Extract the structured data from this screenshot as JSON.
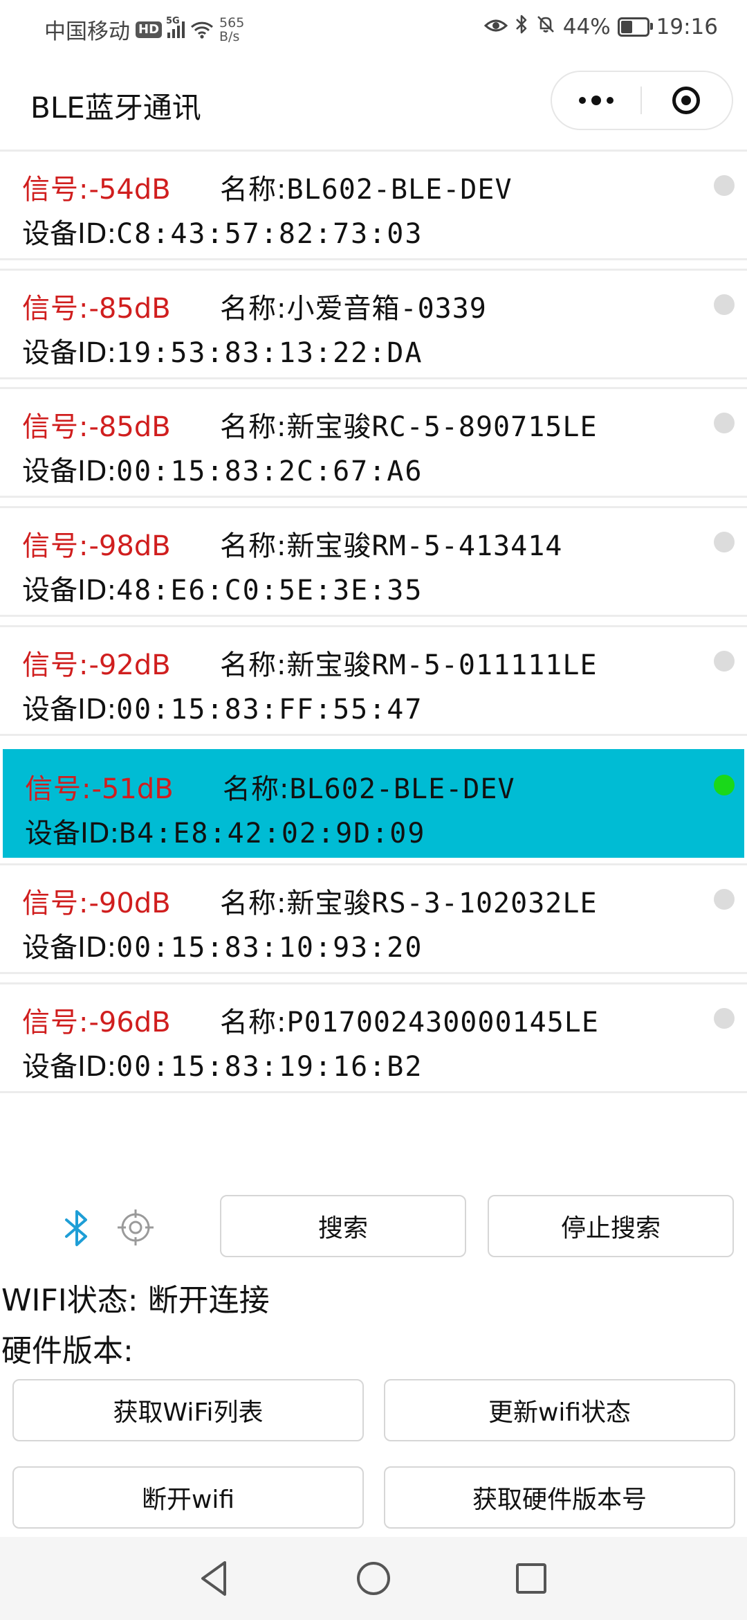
{
  "status_bar": {
    "carrier": "中国移动",
    "hd_label": "HD",
    "network_label": "5G",
    "speed_value": "565",
    "speed_unit": "B/s",
    "battery_percent": "44%",
    "time": "19:16",
    "battery_level": 0.44
  },
  "nav": {
    "title": "BLE蓝牙通讯"
  },
  "labels": {
    "signal": "信号:",
    "name": "名称:",
    "device_id": "设备ID:"
  },
  "devices": [
    {
      "rssi": "-54dB",
      "name": "BL602-BLE-DEV",
      "id": "C8:43:57:82:73:03",
      "connected": false
    },
    {
      "rssi": "-85dB",
      "name": "小爱音箱-0339",
      "id": "19:53:83:13:22:DA",
      "connected": false
    },
    {
      "rssi": "-85dB",
      "name": "新宝骏RC-5-890715LE",
      "id": "00:15:83:2C:67:A6",
      "connected": false
    },
    {
      "rssi": "-98dB",
      "name": "新宝骏RM-5-413414",
      "id": "48:E6:C0:5E:3E:35",
      "connected": false
    },
    {
      "rssi": "-92dB",
      "name": "新宝骏RM-5-011111LE",
      "id": "00:15:83:FF:55:47",
      "connected": false
    },
    {
      "rssi": "-51dB",
      "name": "BL602-BLE-DEV",
      "id": "B4:E8:42:02:9D:09",
      "connected": true
    },
    {
      "rssi": "-90dB",
      "name": "新宝骏RS-3-102032LE",
      "id": "00:15:83:10:93:20",
      "connected": false
    },
    {
      "rssi": "-96dB",
      "name": "P017002430000145LE",
      "id": "00:15:83:19:16:B2",
      "connected": false
    }
  ],
  "controls": {
    "search_label": "搜索",
    "stop_search_label": "停止搜索",
    "wifi_status_label": "WIFI状态:",
    "wifi_status_value": "断开连接",
    "hw_version_label": "硬件版本:",
    "hw_version_value": "",
    "get_wifi_list_label": "获取WiFi列表",
    "update_wifi_status_label": "更新wifi状态",
    "disconnect_wifi_label": "断开wifi",
    "get_hw_version_label": "获取硬件版本号"
  },
  "colors": {
    "selected_bg": "#00bcd4",
    "rssi_text": "#d01e1e",
    "connected_dot": "#1ad81a",
    "idle_dot": "#dcdcdc",
    "bluetooth_icon": "#1e9ed6"
  },
  "icons": {
    "bluetooth": "bluetooth-icon",
    "locate": "locate-icon",
    "back": "back-triangle-icon",
    "home": "home-circle-icon",
    "recents": "recents-square-icon"
  }
}
